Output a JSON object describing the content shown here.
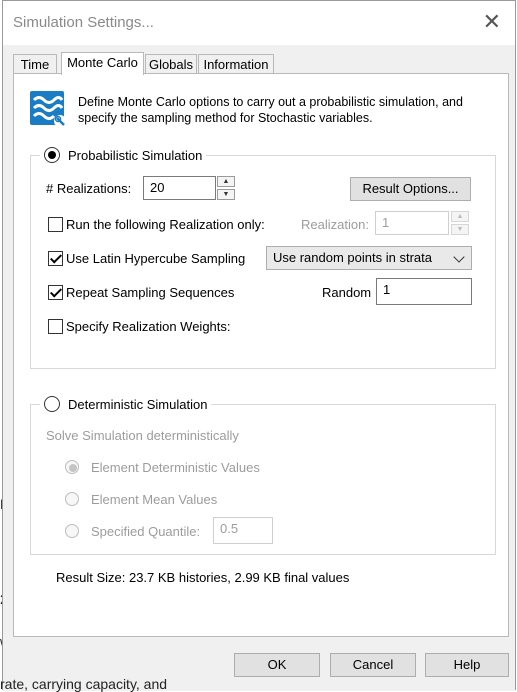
{
  "window": {
    "title": "Simulation Settings...",
    "close_glyph": "✕"
  },
  "background_fragments": {
    "frag1": "N",
    "frag2": "2",
    "frag3": "\\",
    "frag4": "rate, carrying capacity, and"
  },
  "tabs": [
    {
      "label": "Time",
      "active": false
    },
    {
      "label": "Monte Carlo",
      "active": true
    },
    {
      "label": "Globals",
      "active": false
    },
    {
      "label": "Information",
      "active": false
    }
  ],
  "description": "Define Monte Carlo options to carry out a probabilistic simulation, and specify the sampling method for Stochastic variables.",
  "probabilistic": {
    "label": "Probabilistic Simulation",
    "selected": true,
    "realizations_label": "# Realizations:",
    "realizations_value": "20",
    "result_options_label": "Result Options...",
    "run_only_label": "Run the following Realization only:",
    "run_only_checked": false,
    "realization_label": "Realization:",
    "realization_value": "1",
    "lhs_label": "Use Latin Hypercube Sampling",
    "lhs_checked": true,
    "lhs_method": "Use random points in strata",
    "repeat_label": "Repeat Sampling Sequences",
    "repeat_checked": true,
    "random_label": "Random",
    "random_value": "1",
    "weights_label": "Specify Realization Weights:",
    "weights_checked": false
  },
  "deterministic": {
    "label": "Deterministic Simulation",
    "selected": false,
    "solve_label": "Solve Simulation deterministically",
    "options": [
      {
        "label": "Element Deterministic Values",
        "selected": true
      },
      {
        "label": "Element Mean Values",
        "selected": false
      },
      {
        "label": "Specified Quantile:",
        "selected": false
      }
    ],
    "quantile_value": "0.5"
  },
  "result_size": "Result Size: 23.7 KB histories, 2.99 KB final values",
  "buttons": {
    "ok": "OK",
    "cancel": "Cancel",
    "help": "Help"
  },
  "icons": {
    "info": "monte-carlo-settings-icon",
    "up": "▲",
    "down": "▼"
  },
  "colors": {
    "accent": "#1e6fb8",
    "icon_bg": "#1a7dc4"
  }
}
